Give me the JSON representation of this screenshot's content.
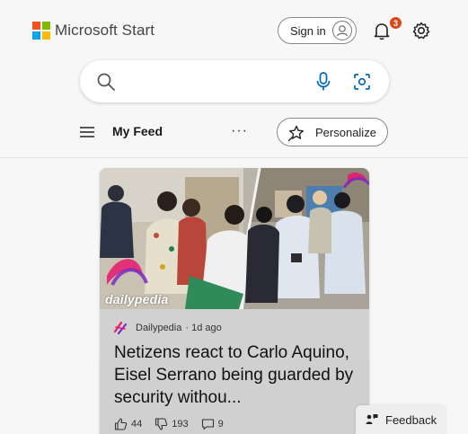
{
  "brand": {
    "name": "Microsoft Start",
    "logo_colors": [
      "#f25022",
      "#7fba00",
      "#00a4ef",
      "#ffb900"
    ]
  },
  "header": {
    "signin_label": "Sign in",
    "notification_count": "3"
  },
  "search": {
    "placeholder": "",
    "accent_color": "#0067b8"
  },
  "nav": {
    "feed_label": "My Feed",
    "more_label": "···",
    "personalize_label": "Personalize"
  },
  "card": {
    "image_watermark": "dailypedia",
    "source": "Dailypedia",
    "time": "· 1d ago",
    "headline": "Netizens react to Carlo Aquino, Eisel Serrano being guarded by security withou...",
    "likes": "44",
    "dislikes": "193",
    "comments": "9",
    "source_colors": [
      "#e8186d",
      "#7b2cbf"
    ]
  },
  "feedback": {
    "label": "Feedback"
  }
}
